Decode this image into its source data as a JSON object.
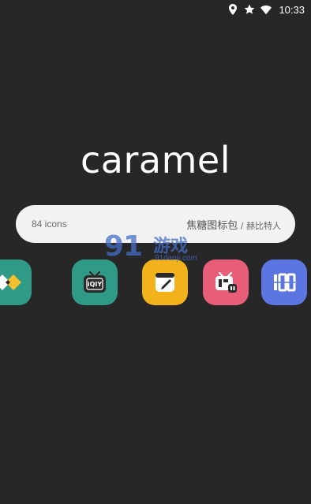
{
  "status_bar": {
    "time": "10:33",
    "icons": [
      "location-icon",
      "star-icon",
      "wifi-icon"
    ]
  },
  "hero": {
    "title": "caramel"
  },
  "info_card": {
    "icon_count": "84 icons",
    "pack_name": "焦糖图标包",
    "separator": " / ",
    "author": "赫比特人"
  },
  "watermark": {
    "number": "91",
    "text": "游戏",
    "url": "91danji.com"
  },
  "app_icons": [
    {
      "name": "diamond-app-icon",
      "color": "#2f9b87"
    },
    {
      "name": "iqiyi-tv-icon",
      "color": "#2f9b87"
    },
    {
      "name": "notes-edit-icon",
      "color": "#f2b21b"
    },
    {
      "name": "bilibili-tv-icon",
      "color": "#e85d78"
    },
    {
      "name": "hundred-app-icon",
      "color": "#5b76e0"
    }
  ],
  "colors": {
    "background": "#272727",
    "pill": "#f2f2f2"
  }
}
